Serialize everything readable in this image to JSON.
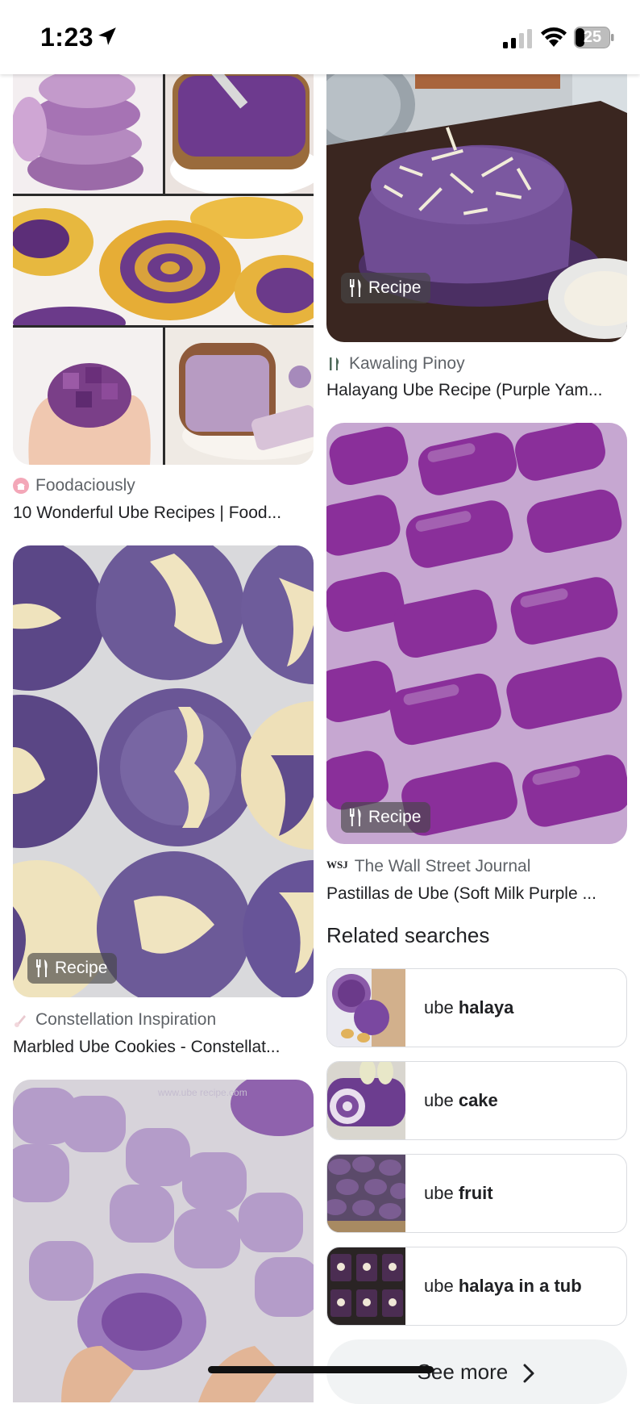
{
  "status_bar": {
    "time": "1:23",
    "battery": "25"
  },
  "pins": [
    {
      "source": "Foodaciously",
      "title": "10 Wonderful Ube Recipes | Food..."
    },
    {
      "badge": "Recipe",
      "source": "Kawaling Pinoy",
      "title": "Halayang Ube Recipe (Purple Yam..."
    },
    {
      "badge": "Recipe",
      "source": "Constellation Inspiration",
      "title": "Marbled Ube Cookies - Constellat..."
    },
    {
      "badge": "Recipe",
      "source_mark": "WSJ",
      "source": "The Wall Street Journal",
      "title": "Pastillas de Ube (Soft Milk Purple ..."
    }
  ],
  "related": {
    "title": "Related searches",
    "items": [
      {
        "prefix": "ube ",
        "bold": "halaya"
      },
      {
        "prefix": "ube ",
        "bold": "cake"
      },
      {
        "prefix": "ube ",
        "bold": "fruit"
      },
      {
        "prefix": "ube ",
        "bold": "halaya in a tub"
      }
    ],
    "see_more": "See more"
  },
  "colors": {
    "ube_purple": "#6b3a8a",
    "card_border": "#dadce0",
    "source_gray": "#5f6368"
  }
}
